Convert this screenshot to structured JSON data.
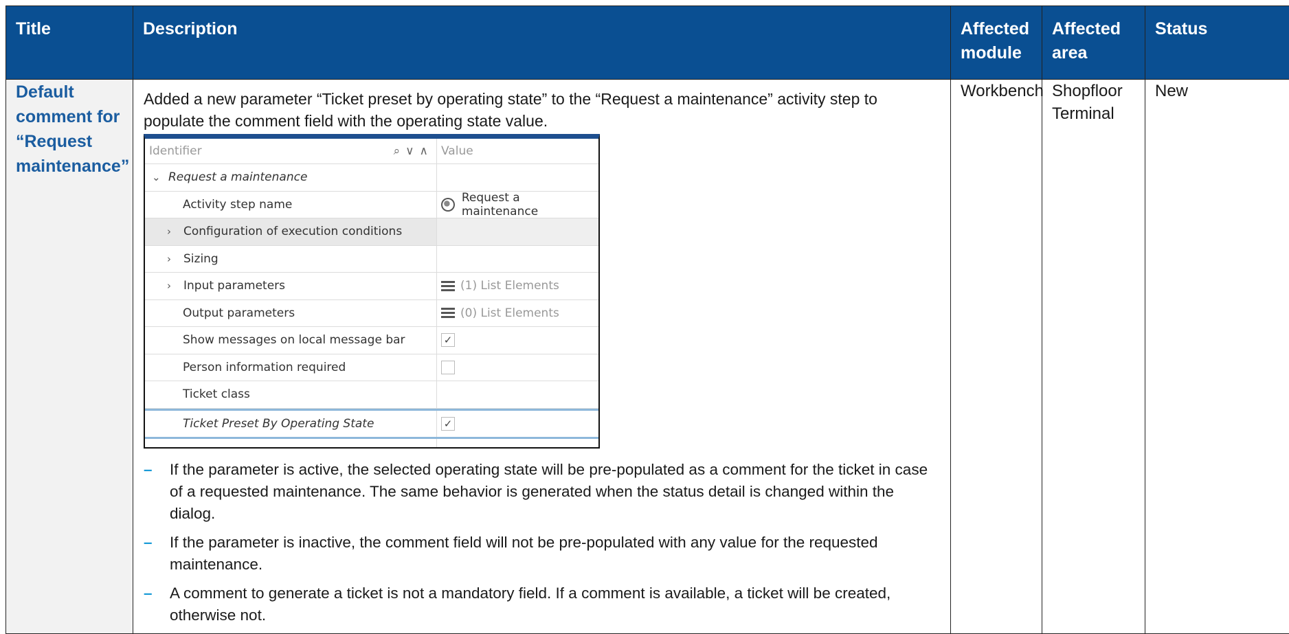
{
  "headers": {
    "title": "Title",
    "description": "Description",
    "module": "Affected\nmodule",
    "area": "Affected\narea",
    "status": "Status"
  },
  "row": {
    "title": "Default\ncomment for\n“Request\nmaintenance”",
    "intro": "Added a new parameter “Ticket preset by operating state” to the “Request a maintenance” activity step to populate the comment field with the operating state value.",
    "module": "Workbench",
    "area": "Shopfloor\nTerminal",
    "status": "New",
    "bullets": [
      "If the parameter is active, the selected operating state will be pre-populated as a comment for the ticket in case of a requested maintenance. The same behavior is generated when the status detail is changed within the dialog.",
      "If the parameter is inactive, the comment field will not be pre-populated with any value for the requested maintenance.",
      "A comment to generate a ticket is not a mandatory field. If a comment is available, a ticket will be created, otherwise not."
    ]
  },
  "screenshot": {
    "col_identifier": "Identifier",
    "col_value": "Value",
    "group": "Request a maintenance",
    "rows": {
      "activity_name": "Activity step name",
      "activity_name_value": "Request a maintenance",
      "exec_conditions": "Configuration of execution conditions",
      "sizing": "Sizing",
      "input_params": "Input parameters",
      "input_params_value": "(1) List Elements",
      "output_params": "Output parameters",
      "output_params_value": "(0) List Elements",
      "show_messages": "Show messages on local message bar",
      "person_info": "Person information required",
      "ticket_class": "Ticket class",
      "ticket_preset": "Ticket Preset By Operating State"
    },
    "checks": {
      "show_messages": true,
      "person_info": false,
      "ticket_preset": true
    }
  }
}
